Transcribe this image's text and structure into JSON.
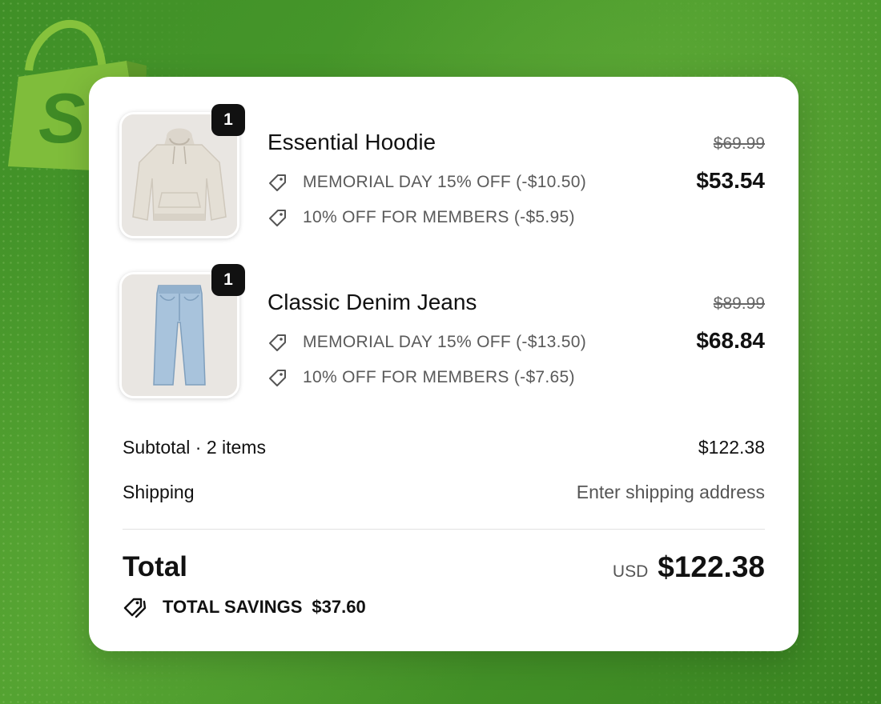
{
  "brand": {
    "logo_icon": "shopify-bag-icon",
    "accent": "#95bf47",
    "background": "#4b9c2c"
  },
  "items": [
    {
      "name": "Essential Hoodie",
      "quantity": "1",
      "image_icon": "hoodie-image",
      "discounts": [
        "MEMORIAL DAY 15% OFF (-$10.50)",
        "10% OFF FOR MEMBERS (-$5.95)"
      ],
      "original_price": "$69.99",
      "price": "$53.54"
    },
    {
      "name": "Classic Denim Jeans",
      "quantity": "1",
      "image_icon": "jeans-image",
      "discounts": [
        "MEMORIAL DAY 15% OFF (-$13.50)",
        "10% OFF FOR MEMBERS (-$7.65)"
      ],
      "original_price": "$89.99",
      "price": "$68.84"
    }
  ],
  "summary": {
    "subtotal_label": "Subtotal · 2 items",
    "subtotal_value": "$122.38",
    "shipping_label": "Shipping",
    "shipping_value": "Enter shipping address",
    "total_label": "Total",
    "currency": "USD",
    "total_value": "$122.38",
    "savings_label": "TOTAL SAVINGS",
    "savings_value": "$37.60"
  }
}
